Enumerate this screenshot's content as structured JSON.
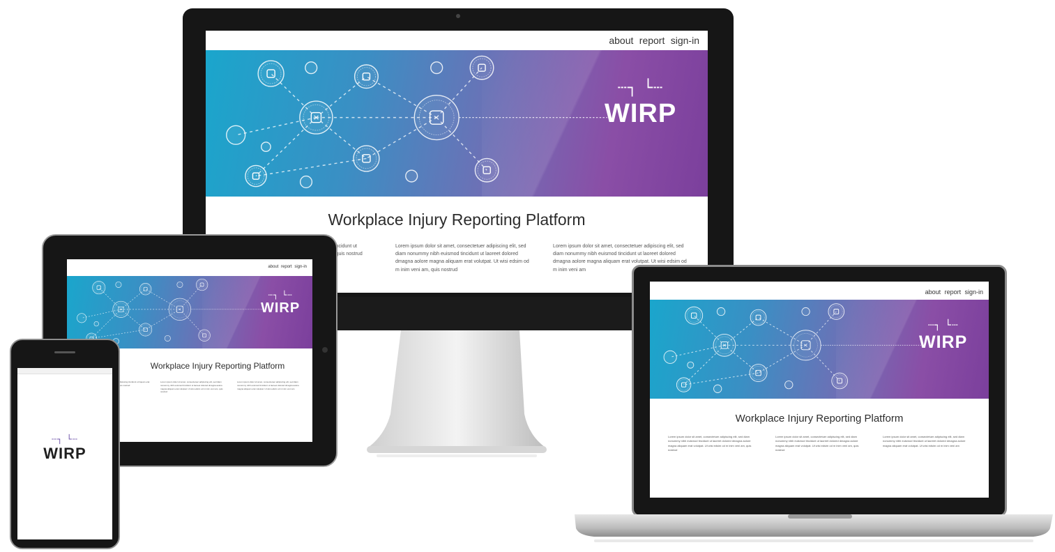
{
  "nav": {
    "about": "about",
    "report": "report",
    "signin": "sign-in"
  },
  "brand": {
    "mark": "┄┐ └┄",
    "name": "WIRP",
    "tm": "™"
  },
  "title": "Workplace Injury Reporting Platform",
  "lorem": [
    "odipiscing tincidunt ut liquam erat quis nostrud",
    "Lorem ipsum dolor sit amet, consectetuer adipiscing elit, sed diam nonummy nibh euismod tincidunt ut laoreet dolored dmagna aolore magna aliquam erat volutpat. Ut wisi edsim od m inim veni am, quis nostrud",
    "Lorem ipsum dolor sit amet, consectetuer adipiscing elit, sed diam nonummy nibh euismod tincidunt ut laoreet dolored dmagna aolore magna aliquam erat volutpat. Ut wisi edsim od m inim veni am"
  ],
  "colors": {
    "teal": "#1aa6cc",
    "purple": "#7b3f9c",
    "bezel": "#161616"
  },
  "icons": [
    "building-icon",
    "worker-icon",
    "shield-icon",
    "ambulance-icon",
    "phone-icon",
    "document-icon",
    "clock-person-icon",
    "help-chat-icon",
    "falling-person-icon",
    "gear-icon",
    "search-icon",
    "handshake-icon",
    "team-icon",
    "network-icon"
  ]
}
